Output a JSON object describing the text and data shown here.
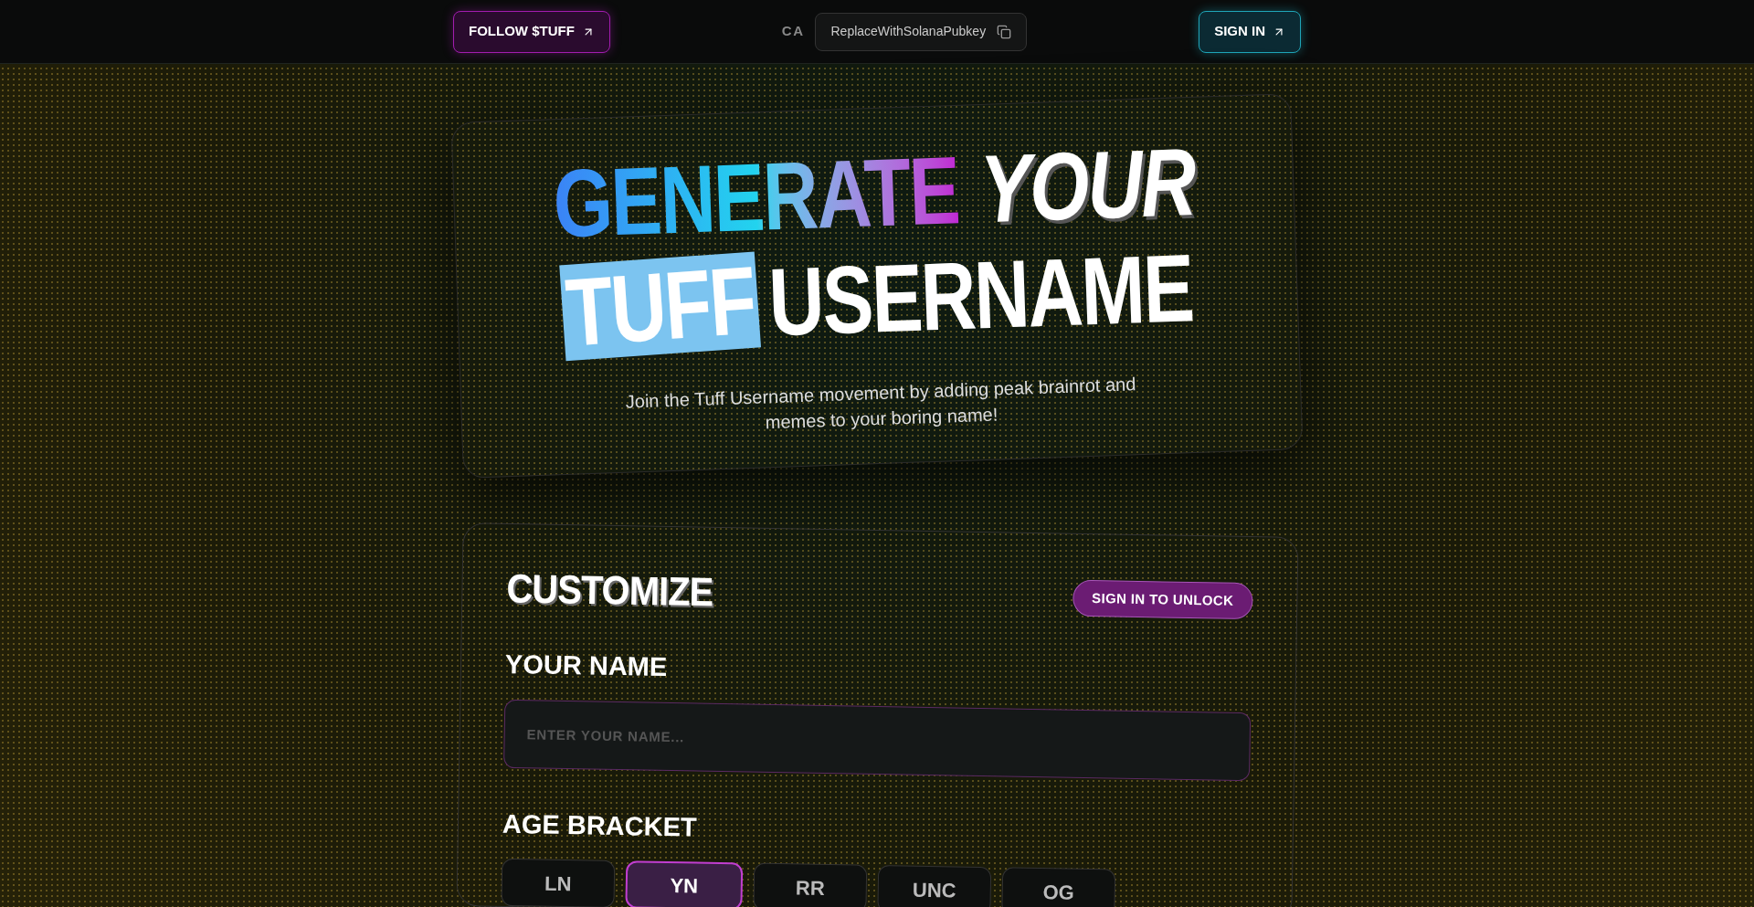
{
  "topbar": {
    "follow_button": "FOLLOW $TUFF",
    "ca_label": "CA",
    "ca_value": "ReplaceWithSolanaPubkey",
    "sign_in_button": "SIGN IN"
  },
  "hero": {
    "title_words": [
      {
        "text": "GENERATE",
        "kind": "gradient"
      },
      {
        "text": "YOUR",
        "kind": "italic"
      },
      {
        "text": "TUFF",
        "kind": "highlight"
      },
      {
        "text": "USERNAME",
        "kind": "plain"
      }
    ],
    "subtitle": "Join the Tuff Username movement by adding peak brainrot and memes to your boring name!"
  },
  "customize": {
    "title": "CUSTOMIZE",
    "unlock_button": "SIGN IN TO UNLOCK",
    "name_label": "YOUR NAME",
    "name_placeholder": "ENTER YOUR NAME...",
    "age_label": "AGE BRACKET",
    "age_options": [
      {
        "label": "LN",
        "selected": false
      },
      {
        "label": "YN",
        "selected": true
      },
      {
        "label": "RR",
        "selected": false
      },
      {
        "label": "UNC",
        "selected": false
      },
      {
        "label": "OG",
        "selected": false
      }
    ]
  }
}
